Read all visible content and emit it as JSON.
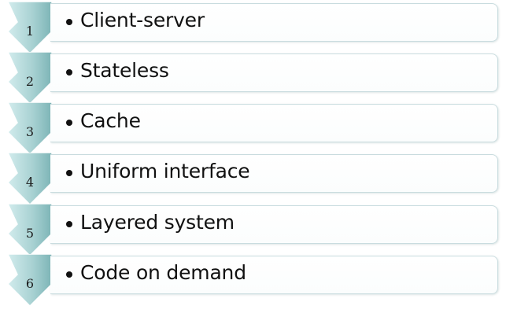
{
  "steps": [
    {
      "number": "1",
      "label": "Client-server"
    },
    {
      "number": "2",
      "label": "Stateless"
    },
    {
      "number": "3",
      "label": "Cache"
    },
    {
      "number": "4",
      "label": "Uniform interface"
    },
    {
      "number": "5",
      "label": "Layered system"
    },
    {
      "number": "6",
      "label": "Code on demand"
    }
  ],
  "colors": {
    "chevron_light": "#d2eced",
    "chevron_dark": "#7cb4b6",
    "panel_border": "#c9dcdf",
    "text": "#111111"
  }
}
